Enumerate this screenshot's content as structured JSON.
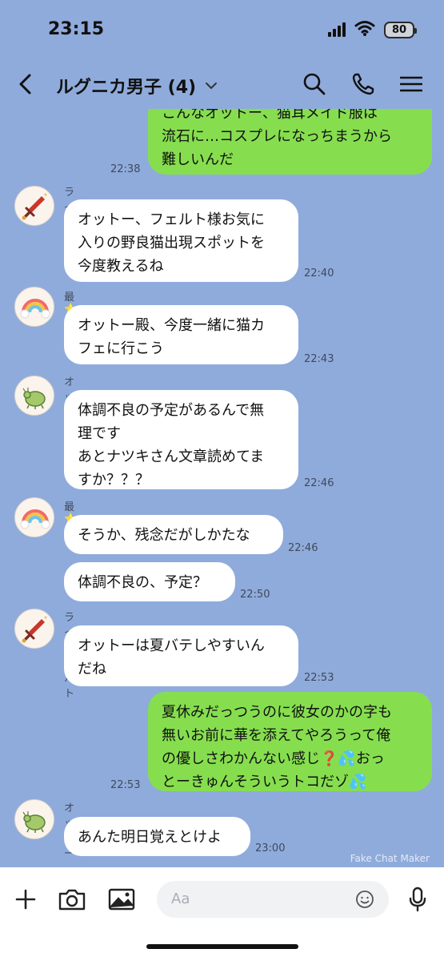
{
  "status": {
    "time": "23:15",
    "battery": "80"
  },
  "header": {
    "title": "ルグニカ男子 (4)"
  },
  "icons": {
    "back": "chevron-left-icon",
    "dropdown": "chevron-down-icon",
    "search": "search-icon",
    "call": "phone-icon",
    "menu": "menu-icon",
    "plus": "plus-icon",
    "camera": "camera-icon",
    "image": "image-icon",
    "emoji": "emoji-icon",
    "mic": "mic-icon"
  },
  "messages": [
    {
      "id": "m0",
      "side": "out",
      "text": "こんなオットー、猫耳メイド服は\n流石に…コスプレになっちまうから\n難しいんだ",
      "time": "22:38"
    },
    {
      "id": "m1",
      "side": "in",
      "sender": "ラインハルト",
      "avatar": "sword-icon",
      "text": "オットー、フェルト様お気に\n入りの野良猫出現スポットを\n今度教えるね",
      "time": "22:40"
    },
    {
      "id": "m2",
      "side": "in",
      "sender": "最⭐️優",
      "avatar": "rainbow-icon",
      "text": "オットー殿、今度一緒に猫カ\nフェに行こう",
      "time": "22:43"
    },
    {
      "id": "m3",
      "side": "in",
      "sender": "オットー",
      "avatar": "bug-icon",
      "text": "体調不良の予定があるんで無\n理です\nあとナツキさん文章読めてま\nすか？？？",
      "time": "22:46"
    },
    {
      "id": "m4",
      "side": "in",
      "sender": "最⭐️優",
      "avatar": "rainbow-icon",
      "text": "そうか、残念だがしかたな",
      "time": "22:46"
    },
    {
      "id": "m5",
      "side": "in",
      "text": "体調不良の、予定？",
      "time": "22:50"
    },
    {
      "id": "m6",
      "side": "in",
      "sender": "ラインハルト",
      "avatar": "sword-icon",
      "text": "オットーは夏バテしやすいん\nだね",
      "time": "22:53"
    },
    {
      "id": "m7",
      "side": "out",
      "text": "夏休みだっつうのに彼女のかの字も\n無いお前に華を添えてやろうって俺\nの優しさわかんない感じ❓💦おっ\nとーきゅんそういうトコだゾ💦",
      "time": "22:53"
    },
    {
      "id": "m8",
      "side": "in",
      "sender": "オットー",
      "avatar": "bug-icon",
      "text": "あんた明日覚えとけよ",
      "time": "23:00"
    }
  ],
  "watermark": "Fake Chat Maker",
  "composer": {
    "placeholder": "Aa"
  },
  "colors": {
    "background": "#8fabdb",
    "outgoing": "#86de4f",
    "incoming": "#ffffff"
  }
}
